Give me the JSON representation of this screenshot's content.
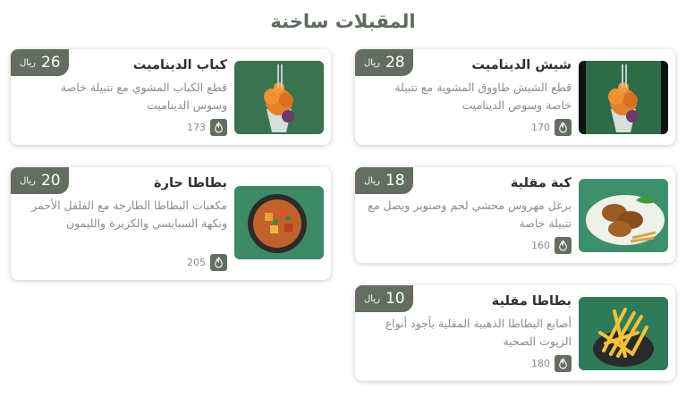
{
  "section": {
    "title": "المقبلات ساخنة"
  },
  "currency": "ريال",
  "items": [
    {
      "name": "شيش الديناميت",
      "desc": "قطع الشيش طاووق المشوية مع تتبيلة خاصة وسوص الديناميت",
      "price": "28",
      "calories": "170",
      "image": "dynamite-skewer"
    },
    {
      "name": "كباب الديناميت",
      "desc": "قطع الكباب المشوي مع تتبيلة خاصة وسوس الديناميت",
      "price": "26",
      "calories": "173",
      "image": "dynamite-skewer"
    },
    {
      "name": "كبة مقلية",
      "desc": "برغل مهروس محشي لحم وصنوبر وبصل مع تتبيلة خاصة",
      "price": "18",
      "calories": "160",
      "image": "fried-kibbeh"
    },
    {
      "name": "بطاطا حارة",
      "desc": "مكعبات البطاطا الطازجة مع الفلفل الأحمر ونكهة السبايسي والكزبرة والليمون",
      "price": "20",
      "calories": "205",
      "image": "spicy-potato-bowl"
    },
    {
      "name": "بطاطا مقلية",
      "desc": "أصابع البطاطا الذهبية المقلية بأجود أنواع الزيوت الصحية",
      "price": "10",
      "calories": "180",
      "image": "french-fries"
    }
  ],
  "colors": {
    "accent": "#636e60",
    "title": "#5e6b5d"
  }
}
